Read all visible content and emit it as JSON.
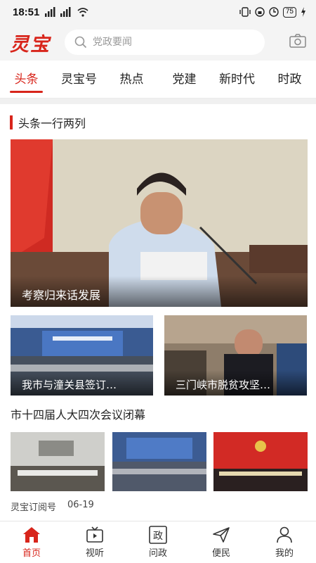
{
  "status_bar": {
    "time": "18:51",
    "signal_left": "4G",
    "battery": "75"
  },
  "header": {
    "logo": "灵宝",
    "search_placeholder": "党政要闻"
  },
  "tabs": [
    {
      "label": "头条",
      "active": true
    },
    {
      "label": "灵宝号",
      "active": false
    },
    {
      "label": "热点",
      "active": false
    },
    {
      "label": "党建",
      "active": false
    },
    {
      "label": "新时代",
      "active": false
    },
    {
      "label": "时政",
      "active": false
    }
  ],
  "section": {
    "title": "头条一行两列"
  },
  "hero": {
    "caption": "考察归来话发展"
  },
  "cards": [
    {
      "caption": "我市与潼关县签订…"
    },
    {
      "caption": "三门峡市脱贫攻坚…"
    }
  ],
  "news": {
    "title": "市十四届人大四次会议闭幕",
    "source": "灵宝订阅号",
    "date": "06-19"
  },
  "bottom_nav": [
    {
      "label": "首页",
      "icon": "home-icon",
      "active": true
    },
    {
      "label": "视听",
      "icon": "tv-icon",
      "active": false
    },
    {
      "label": "问政",
      "icon": "govern-icon",
      "active": false
    },
    {
      "label": "便民",
      "icon": "send-icon",
      "active": false
    },
    {
      "label": "我的",
      "icon": "user-icon",
      "active": false
    }
  ],
  "colors": {
    "accent": "#d8251b",
    "bg": "#f4f4f4"
  }
}
